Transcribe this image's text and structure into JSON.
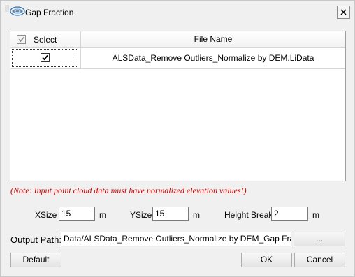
{
  "dialog": {
    "title": "Gap Fraction",
    "logo_text": "LiDAR360",
    "close_label": "✕"
  },
  "table": {
    "headers": {
      "select": "Select",
      "file_name": "File Name"
    },
    "rows": [
      {
        "checked": true,
        "file_name": "ALSData_Remove Outliers_Normalize by DEM.LiData"
      }
    ]
  },
  "note": "(Note: Input point cloud data must have normalized elevation values!)",
  "params": {
    "xsize": {
      "label": "XSize",
      "value": "15",
      "unit": "m"
    },
    "ysize": {
      "label": "YSize",
      "value": "15",
      "unit": "m"
    },
    "height_break": {
      "label": "Height Break",
      "value": "2",
      "unit": "m"
    }
  },
  "output": {
    "label": "Output Path:",
    "value": "Data/ALSData_Remove Outliers_Normalize by DEM_Gap Fraction.tif",
    "browse_label": "..."
  },
  "buttons": {
    "default": "Default",
    "ok": "OK",
    "cancel": "Cancel"
  }
}
